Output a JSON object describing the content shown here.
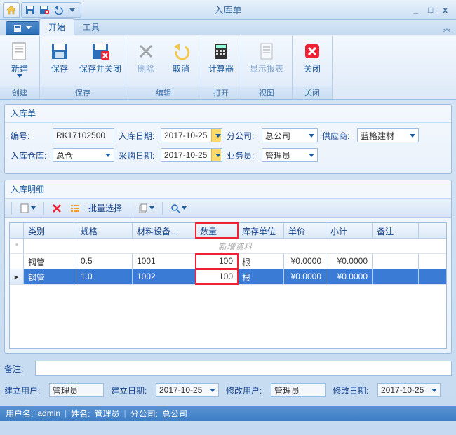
{
  "window": {
    "title": "入库单",
    "min": "_",
    "max": "□",
    "close": "x"
  },
  "tabs": {
    "app": "",
    "start": "开始",
    "tools": "工具"
  },
  "ribbon": {
    "new": "新建",
    "save": "保存",
    "saveClose": "保存并关闭",
    "delete": "删除",
    "cancel": "取消",
    "calc": "计算器",
    "report": "显示报表",
    "close": "关闭",
    "g_create": "创建",
    "g_save": "保存",
    "g_edit": "编辑",
    "g_open": "打开",
    "g_view": "视图",
    "g_close": "关闭"
  },
  "panel1": {
    "title": "入库单",
    "code_l": "编号:",
    "code_v": "RK17102500",
    "date_l": "入库日期:",
    "date_v": "2017-10-25",
    "branch_l": "分公司:",
    "branch_v": "总公司",
    "supplier_l": "供应商:",
    "supplier_v": "蓝格建材",
    "wh_l": "入库仓库:",
    "wh_v": "总仓",
    "pdate_l": "采购日期:",
    "pdate_v": "2017-10-25",
    "clerk_l": "业务员:",
    "clerk_v": "管理员"
  },
  "panel2": {
    "title": "入库明细",
    "batch": "批量选择",
    "newrow": "新增资料",
    "cols": {
      "c1": "类别",
      "c2": "规格",
      "c3": "材料设备…",
      "c4": "数量",
      "c5": "库存单位",
      "c6": "单价",
      "c7": "小计",
      "c8": "备注"
    },
    "rows": [
      {
        "c1": "钢管",
        "c2": "0.5",
        "c3": "1001",
        "c4": "100",
        "c5": "根",
        "c6": "¥0.0000",
        "c7": "¥0.0000",
        "c8": ""
      },
      {
        "c1": "钢管",
        "c2": "1.0",
        "c3": "1002",
        "c4": "100",
        "c5": "根",
        "c6": "¥0.0000",
        "c7": "¥0.0000",
        "c8": ""
      }
    ]
  },
  "remark_l": "备注:",
  "footer": {
    "cu_l": "建立用户:",
    "cu_v": "管理员",
    "cd_l": "建立日期:",
    "cd_v": "2017-10-25",
    "mu_l": "修改用户:",
    "mu_v": "管理员",
    "md_l": "修改日期:",
    "md_v": "2017-10-25"
  },
  "status": {
    "user_l": "用户名:",
    "user_v": "admin",
    "name_l": "姓名:",
    "name_v": "管理员",
    "branch_l": "分公司:",
    "branch_v": "总公司"
  }
}
